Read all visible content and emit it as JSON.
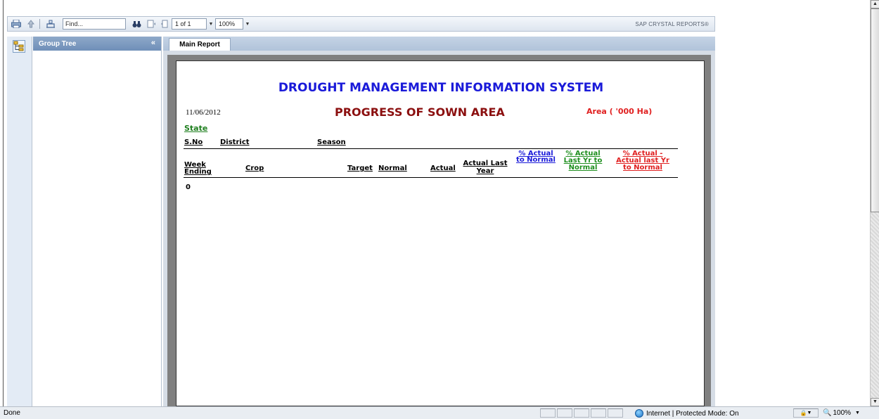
{
  "toolbar": {
    "find_placeholder": "Find...",
    "page_indicator": "1 of 1",
    "zoom_value": "100%",
    "brand": "SAP CRYSTAL REPORTS®"
  },
  "group_tree": {
    "title": "Group Tree",
    "collapse": "«"
  },
  "tabs": {
    "main_report": "Main Report"
  },
  "report": {
    "title": "DROUGHT MANAGEMENT INFORMATION SYSTEM",
    "date": "11/06/2012",
    "subtitle": "PROGRESS OF SOWN AREA",
    "area_unit": "Area ( '000 Ha)",
    "state_label": "State",
    "group_headers": {
      "sno": "S.No",
      "district": "District",
      "season": "Season"
    },
    "columns": {
      "week_ending_1": "Week",
      "week_ending_2": "Ending",
      "crop": "Crop",
      "target": "Target",
      "normal": "Normal",
      "actual": "Actual",
      "actual_last_year_1": "Actual Last",
      "actual_last_year_2": "Year",
      "pct_actual_normal_1": "% Actual",
      "pct_actual_normal_2": "to Normal",
      "pct_actual_last_yr_1": "% Actual",
      "pct_actual_last_yr_2": "Last Yr to",
      "pct_actual_last_yr_3": "Normal",
      "pct_diff_1": "% Actual  -",
      "pct_diff_2": "Actual last Yr",
      "pct_diff_3": "to Normal"
    },
    "first_value": "0"
  },
  "statusbar": {
    "status": "Done",
    "zone": "Internet | Protected Mode: On",
    "zoom": "100%"
  },
  "colors": {
    "title_blue": "#1a1ad9",
    "subtitle_maroon": "#8b0f0f",
    "accent_red": "#e02020",
    "accent_green": "#1f8f1f"
  }
}
